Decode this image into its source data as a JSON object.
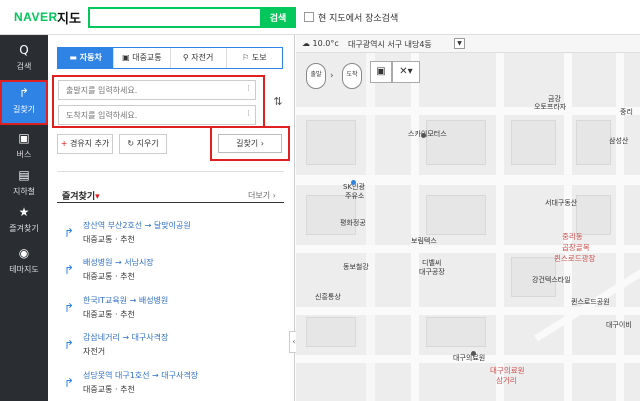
{
  "header": {
    "logo": "NAVER",
    "logo_sub": "지도",
    "search_placeholder": "",
    "search_button": "검색",
    "inmap_label": "현 지도에서 장소검색"
  },
  "leftnav": {
    "items": [
      {
        "icon": "Q",
        "label": "검색"
      },
      {
        "icon": "↱",
        "label": "길찾기"
      },
      {
        "icon": "▣",
        "label": "버스"
      },
      {
        "icon": "▤",
        "label": "지하철"
      },
      {
        "icon": "★",
        "label": "즐겨찾기"
      },
      {
        "icon": "◉",
        "label": "테마지도"
      }
    ],
    "active_index": 1
  },
  "mode_tabs": [
    {
      "icon": "🚗",
      "label": "자동차",
      "active": true
    },
    {
      "icon": "🚌",
      "label": "대중교통",
      "active": false
    },
    {
      "icon": "🚲",
      "label": "자전거",
      "active": false
    },
    {
      "icon": "🚶",
      "label": "도보",
      "active": false
    }
  ],
  "route": {
    "start_placeholder": "출발지를 입력하세요.",
    "end_placeholder": "도착지를 입력하세요.",
    "add_waypoint": "경유지 추가",
    "clear": "지우기",
    "find": "길찾기"
  },
  "favorites": {
    "title": "즐겨찾기",
    "more": "더보기",
    "items": [
      {
        "route": "장산역 부산2호선 → 달맞이공원",
        "type": "대중교통",
        "tag": "추천"
      },
      {
        "route": "배성병원 → 서남시장",
        "type": "대중교통",
        "tag": "추천"
      },
      {
        "route": "한국IT교육원 → 배성병원",
        "type": "대중교통",
        "tag": "추천"
      },
      {
        "route": "감삼네거리 → 대구사격장",
        "type": "자전거",
        "tag": ""
      },
      {
        "route": "성당못역 대구1호선 → 대구사격장",
        "type": "대중교통",
        "tag": "추천"
      }
    ]
  },
  "map": {
    "weather": "10.0°c",
    "location": "대구광역시 서구 내당4동",
    "pins": {
      "start": "출발",
      "end": "도착"
    },
    "labels": [
      "금강",
      "오토프라자",
      "중리",
      "스카이모터스",
      "삼성산",
      "SK인광",
      "주유소",
      "서대구동산",
      "평화정공",
      "중리동",
      "곱창골목",
      "보림텍스",
      "퀸스로드광장",
      "동보철강",
      "디벨씨",
      "대구공장",
      "강건텍스타일",
      "신흥통상",
      "퀸스로드공원",
      "대구이비",
      "대구의료원",
      "대구의료원",
      "삼거리"
    ]
  }
}
